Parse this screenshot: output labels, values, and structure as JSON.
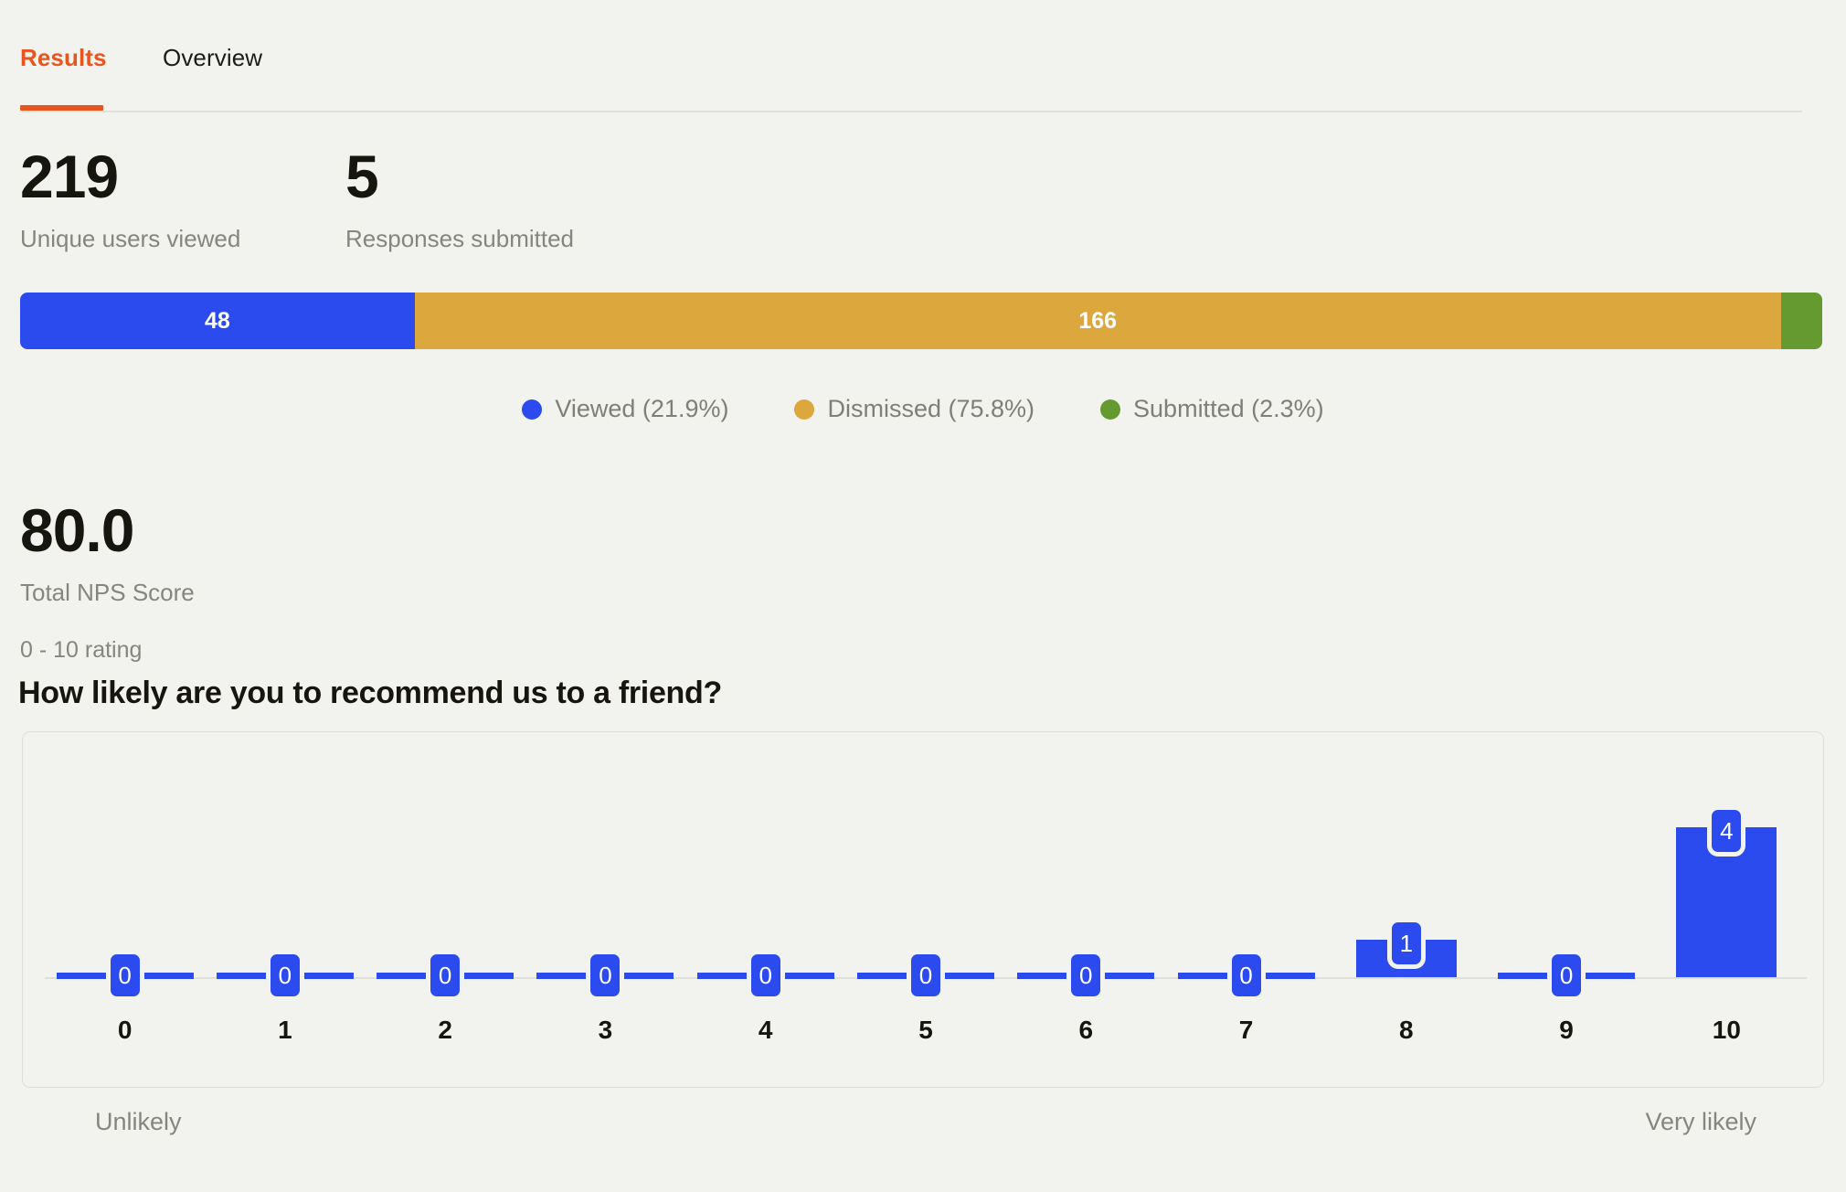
{
  "tabs": [
    {
      "label": "Results",
      "active": true
    },
    {
      "label": "Overview",
      "active": false
    }
  ],
  "stats": [
    {
      "value": "219",
      "label": "Unique users viewed"
    },
    {
      "value": "5",
      "label": "Responses submitted"
    }
  ],
  "funnel": {
    "segments": [
      {
        "name": "Viewed",
        "count": "48",
        "percent": "21.9%",
        "color": "#2b4bee",
        "width_pct": 21.9
      },
      {
        "name": "Dismissed",
        "count": "166",
        "percent": "75.8%",
        "color": "#dca73c",
        "width_pct": 75.8
      },
      {
        "name": "Submitted",
        "count": "",
        "percent": "2.3%",
        "color": "#649a2f",
        "width_pct": 2.3
      }
    ],
    "legend": [
      {
        "label": "Viewed (21.9%)",
        "color": "#2b4bee"
      },
      {
        "label": "Dismissed (75.8%)",
        "color": "#dca73c"
      },
      {
        "label": "Submitted (2.3%)",
        "color": "#649a2f"
      }
    ]
  },
  "nps": {
    "value": "80.0",
    "label": "Total NPS Score"
  },
  "question": {
    "subtitle": "0 - 10 rating",
    "title": "How likely are you to recommend us to a friend?",
    "scale_low": "Unlikely",
    "scale_high": "Very likely"
  },
  "chart_data": {
    "type": "bar",
    "title": "How likely are you to recommend us to a friend?",
    "subtitle": "0 - 10 rating",
    "xlabel": "",
    "ylabel": "",
    "categories": [
      "0",
      "1",
      "2",
      "3",
      "4",
      "5",
      "6",
      "7",
      "8",
      "9",
      "10"
    ],
    "values": [
      0,
      0,
      0,
      0,
      0,
      0,
      0,
      0,
      1,
      0,
      4
    ],
    "data_labels": [
      "0",
      "0",
      "0",
      "0",
      "0",
      "0",
      "0",
      "0",
      "1",
      "0",
      "4"
    ],
    "ylim": [
      0,
      4
    ],
    "grid": false,
    "legend": "none",
    "bar_color": "#2b4bee",
    "axis_low_label": "Unlikely",
    "axis_high_label": "Very likely"
  }
}
